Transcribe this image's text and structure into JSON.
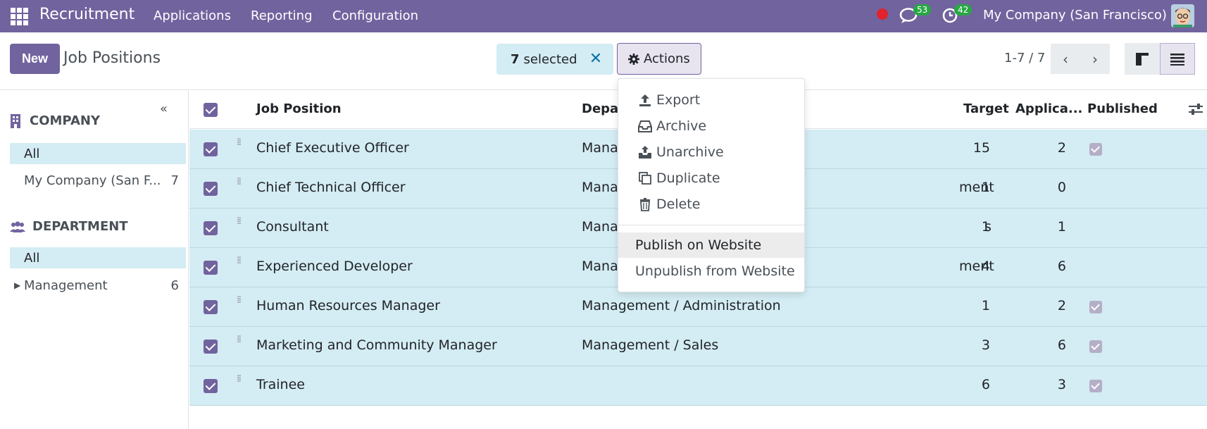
{
  "navbar": {
    "app_name": "Recruitment",
    "menus": [
      "Applications",
      "Reporting",
      "Configuration"
    ],
    "chat_count": "53",
    "activity_count": "42",
    "company": "My Company (San Francisco)"
  },
  "control": {
    "new_label": "New",
    "title": "Job Positions",
    "selected_count": "7",
    "selected_text": "selected",
    "actions_label": "Actions",
    "pager": "1-7 / 7"
  },
  "sidebar": {
    "company_header": "COMPANY",
    "company_items": [
      {
        "label": "All",
        "count": ""
      },
      {
        "label": "My Company (San F...",
        "count": "7"
      }
    ],
    "department_header": "DEPARTMENT",
    "department_items": [
      {
        "label": "All",
        "count": ""
      },
      {
        "label": "Management",
        "count": "6"
      }
    ]
  },
  "table": {
    "headers": {
      "job_position": "Job Position",
      "department": "Depar",
      "target": "Target",
      "applications": "Applica...",
      "published": "Published"
    },
    "rows": [
      {
        "name": "Chief Executive Officer",
        "department": "Mana",
        "target": "15",
        "applications": "2",
        "published": true
      },
      {
        "name": "Chief Technical Officer",
        "department": "Mana",
        "dept_tail": "ment",
        "target": "1",
        "applications": "0",
        "published": false
      },
      {
        "name": "Consultant",
        "department": "Mana",
        "dept_tail": "s",
        "target": "1",
        "applications": "1",
        "published": false
      },
      {
        "name": "Experienced Developer",
        "department": "Mana",
        "dept_tail": "ment",
        "target": "4",
        "applications": "6",
        "published": false
      },
      {
        "name": "Human Resources Manager",
        "department": "Management / Administration",
        "target": "1",
        "applications": "2",
        "published": true
      },
      {
        "name": "Marketing and Community Manager",
        "department": "Management / Sales",
        "target": "3",
        "applications": "6",
        "published": true
      },
      {
        "name": "Trainee",
        "department": "",
        "target": "6",
        "applications": "3",
        "published": true
      }
    ]
  },
  "dropdown": {
    "items": [
      "Export",
      "Archive",
      "Unarchive",
      "Duplicate",
      "Delete"
    ],
    "publish": "Publish on Website",
    "unpublish": "Unpublish from Website"
  },
  "colors": {
    "brand": "#71639e",
    "selection": "#d4ecf3",
    "badge": "#28a745"
  }
}
